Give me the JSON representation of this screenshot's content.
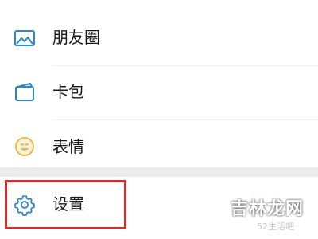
{
  "menu": {
    "items": [
      {
        "label": "朋友圈",
        "icon": "moments-photo-icon"
      },
      {
        "label": "卡包",
        "icon": "card-wallet-icon"
      },
      {
        "label": "表情",
        "icon": "sticker-smile-icon"
      }
    ],
    "settings": {
      "label": "设置",
      "icon": "gear-icon"
    }
  },
  "watermark": {
    "text": "吉林龙网",
    "subtext": "52生活吧"
  },
  "colors": {
    "icon_blue": "#2f86c8",
    "sticker_yellow": "#e8b84a",
    "highlight_red": "#d22f2f",
    "background": "#ededed"
  }
}
